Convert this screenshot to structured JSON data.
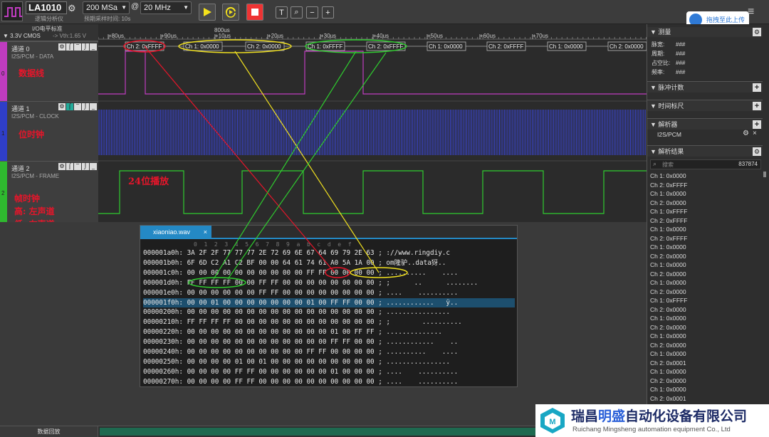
{
  "toolbar": {
    "device": "LA1010",
    "device_sub": "逻辑分析仪",
    "sample_rate": "200 MSa",
    "at": "@",
    "freq": "20 MHz",
    "est_time": "预期采样时间: 10s",
    "upload": "拖拽至此上传"
  },
  "io": {
    "title": "I/O电平标准",
    "value": "3.3V CMOS",
    "vth": "-> Vth:1.65 V"
  },
  "channels": [
    {
      "name": "通道 0",
      "proto": "I2S/PCM - DATA",
      "num": "0",
      "color": "#c03cc0",
      "label": "数据线"
    },
    {
      "name": "通道 1",
      "proto": "I2S/PCM - CLOCK",
      "num": "1",
      "color": "#2f3ec8",
      "label": "位时钟"
    },
    {
      "name": "通道 2",
      "proto": "I2S/PCM - FRAME",
      "num": "2",
      "color": "#2fb82f",
      "label": "帧时钟",
      "label2": "高: 左声道",
      "label3": "低: 右声道"
    }
  ],
  "wave_note": "24位播放",
  "ruler": {
    "center": "800us",
    "ticks": [
      "+80us",
      "+90us",
      "+10us",
      "+20us",
      "+30us",
      "+40us",
      "+50us",
      "+60us",
      "+70us"
    ]
  },
  "decode_tags": [
    "Ch 2: 0xFFFF",
    "Ch 1: 0x0000",
    "Ch 2: 0x0000",
    "Ch 1: 0xFFFF",
    "Ch 2: 0xFFFF",
    "Ch 1: 0x0000",
    "Ch 2: 0xFFFF",
    "Ch 1: 0x0000",
    "Ch 2: 0x0000"
  ],
  "hex": {
    "filename": "xiaoniao.wav",
    "close": "×",
    "header": "0  1  2  3  4  5  6  7  8  9  a  b  c  d  e  f",
    "rows": [
      "000001a0h: 3A 2F 2F 77 77 77 2E 72 69 6E 67 64 69 79 2E 63 ; ://www.ringdiy.c",
      "000001b0h: 6F 6D C2 A1 C2 BF 00 00 64 61 74 61 A0 5A 1A 00 ; om隆驴..data犽..",
      "000001c0h: 00 00 00 00 00 00 00 00 00 00 FF FF 00 00 00 00 ; ..........    ....",
      "000001d0h: FF FF FF FF 00 00 FF FF 00 00 00 00 00 00 00 00 ; ;      ..      ........",
      "000001e0h: 00 00 00 00 00 00 FF FF 00 00 00 00 00 00 00 00 ; ....    ..........",
      "000001f0h: 00 00 01 00 00 00 00 00 00 00 01 00 FF FF 00 00 ; ............   ÿ..",
      "00000200h: 00 00 00 00 00 00 00 00 00 00 00 00 00 00 00 00 ; ................",
      "00000210h: FF FF FF FF 00 00 00 00 00 00 00 00 00 00 00 00 ; ;        ..........",
      "00000220h: 00 00 00 00 00 00 00 00 00 00 00 00 01 00 FF FF ; ..............",
      "00000230h: 00 00 00 00 00 00 00 00 00 00 00 00 FF FF 00 00 ; ............    ..",
      "00000240h: 00 00 00 00 00 00 00 00 00 00 FF FF 00 00 00 00 ; ..........    ....",
      "00000250h: 00 00 00 00 01 00 01 00 00 00 00 00 00 00 00 00 ; ................",
      "00000260h: 00 00 00 00 FF FF 00 00 00 00 00 00 01 00 00 00 ; ....    ..........",
      "00000270h: 00 00 00 00 FF FF 00 00 00 00 00 00 00 00 00 00 ; ....    .........."
    ]
  },
  "right": {
    "measure": "测量",
    "pulse_width": "脉宽:",
    "period": "周期:",
    "duty": "占空比:",
    "freq": "频率:",
    "hash": "###",
    "pulse_count": "脉冲计数",
    "time_marker": "时间标尺",
    "decoder": "解析器",
    "decoder_item": "I2S/PCM",
    "results": "解析结果",
    "search": "搜索",
    "count": "837874",
    "result_items": [
      "Ch 1: 0x0000",
      "Ch 2: 0xFFFF",
      "Ch 1: 0x0000",
      "Ch 2: 0x0000",
      "Ch 1: 0xFFFF",
      "Ch 2: 0xFFFF",
      "Ch 1: 0x0000",
      "Ch 2: 0xFFFF",
      "Ch 1: 0x0000",
      "Ch 2: 0x0000",
      "Ch 1: 0x0000",
      "Ch 2: 0x0000",
      "Ch 1: 0x0000",
      "Ch 2: 0x0000",
      "Ch 1: 0xFFFF",
      "Ch 2: 0x0000",
      "Ch 1: 0x0000",
      "Ch 2: 0x0000",
      "Ch 1: 0x0000",
      "Ch 2: 0x0000",
      "Ch 1: 0x0000",
      "Ch 2: 0x0001",
      "Ch 1: 0x0000",
      "Ch 2: 0x0000",
      "Ch 1: 0x0000",
      "Ch 2: 0x0001"
    ]
  },
  "status": "数据回放",
  "watermark": {
    "cn1": "瑞昌",
    "cn2": "明盛",
    "cn3": "自动化设备有限公司",
    "en": "Ruichang Mingsheng automation equipment Co., Ltd"
  }
}
